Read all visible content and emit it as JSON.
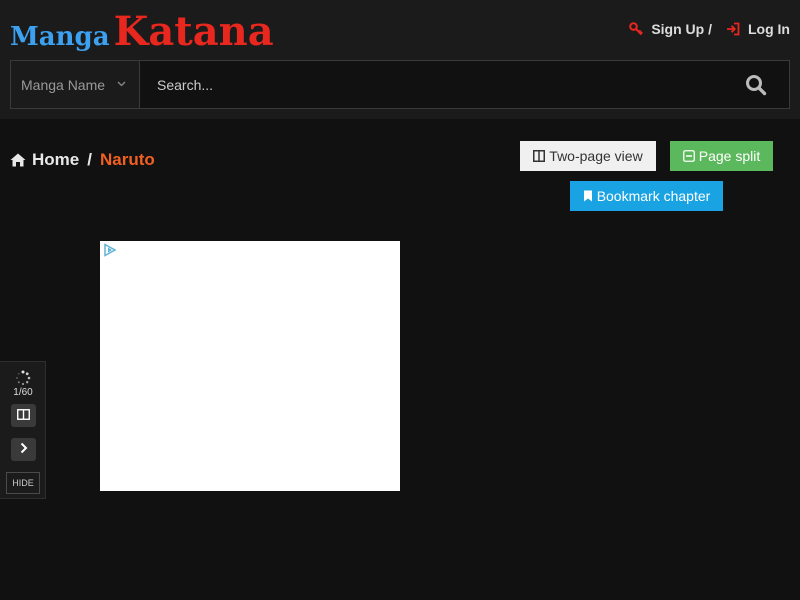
{
  "header": {
    "logo": {
      "small": "Manga",
      "big": "Katana"
    },
    "auth": {
      "signup_label": "Sign Up /",
      "login_label": "Log In"
    }
  },
  "search": {
    "select_value": "Manga Name",
    "placeholder": "Search..."
  },
  "breadcrumb": {
    "home_label": "Home",
    "separator": "/",
    "current_label": "Naruto"
  },
  "reader_buttons": {
    "two_page_label": "Two-page view",
    "page_split_label": "Page split",
    "bookmark_label": "Bookmark chapter"
  },
  "side_panel": {
    "page_indicator": "1/60",
    "hide_label": "HIDE"
  },
  "colors": {
    "accent_red": "#e8271f",
    "logo_blue": "#3ca1f0",
    "breadcrumb_current": "#f06022",
    "split_green": "#5cb85c",
    "bookmark_blue": "#1aa3e3"
  }
}
